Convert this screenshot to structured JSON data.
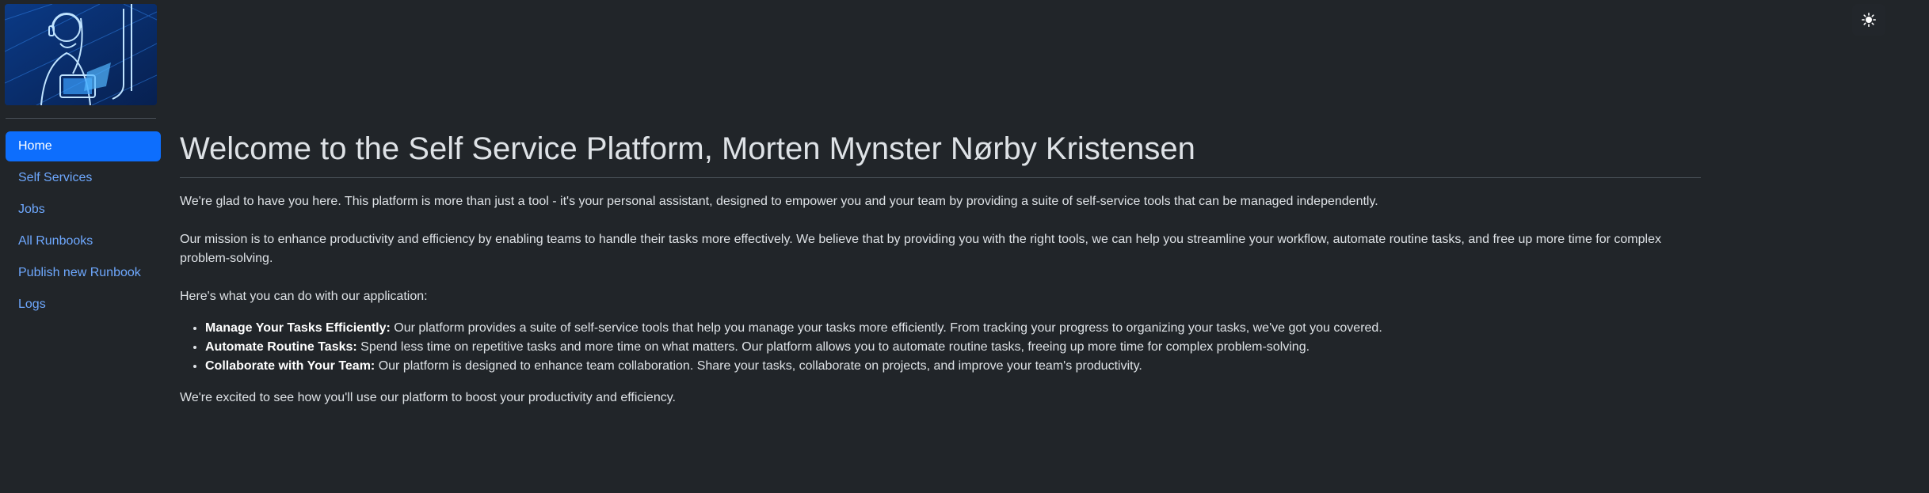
{
  "sidebar": {
    "logo_icon": "support-agent-logo-image",
    "items": [
      {
        "label": "Home",
        "active": true
      },
      {
        "label": "Self Services",
        "active": false
      },
      {
        "label": "Jobs",
        "active": false
      },
      {
        "label": "All Runbooks",
        "active": false
      },
      {
        "label": "Publish new Runbook",
        "active": false
      },
      {
        "label": "Logs",
        "active": false
      }
    ]
  },
  "header": {
    "theme_toggle_icon": "sun-icon",
    "theme_toggle_glyph": "☀"
  },
  "main": {
    "title": "Welcome to the Self Service Platform, Morten Mynster Nørby Kristensen",
    "intro": "We're glad to have you here. This platform is more than just a tool - it's your personal assistant, designed to empower you and your team by providing a suite of self-service tools that can be managed independently.",
    "mission": "Our mission is to enhance productivity and efficiency by enabling teams to handle their tasks more effectively. We believe that by providing you with the right tools, we can help you streamline your workflow, automate routine tasks, and free up more time for complex problem-solving.",
    "features_intro": "Here's what you can do with our application:",
    "features": [
      {
        "title": "Manage Your Tasks Efficiently:",
        "text": " Our platform provides a suite of self-service tools that help you manage your tasks more efficiently. From tracking your progress to organizing your tasks, we've got you covered."
      },
      {
        "title": "Automate Routine Tasks:",
        "text": " Spend less time on repetitive tasks and more time on what matters. Our platform allows you to automate routine tasks, freeing up more time for complex problem-solving."
      },
      {
        "title": "Collaborate with Your Team:",
        "text": " Our platform is designed to enhance team collaboration. Share your tasks, collaborate on projects, and improve your team's productivity."
      }
    ],
    "closing": "We're excited to see how you'll use our platform to boost your productivity and efficiency."
  },
  "colors": {
    "background": "#212529",
    "accent": "#0d6efd",
    "link": "#6ea8fe",
    "text": "#dee2e6"
  }
}
